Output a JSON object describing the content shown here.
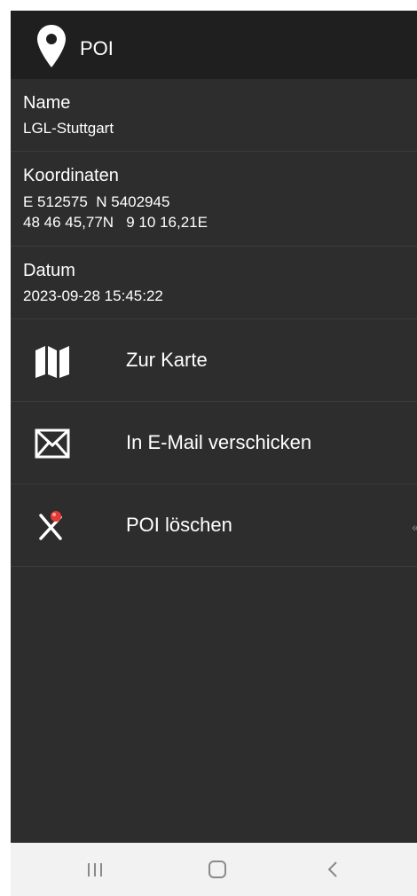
{
  "appbar": {
    "title": "POI",
    "icon": "map-pin-icon"
  },
  "details": {
    "name_label": "Name",
    "name_value": "LGL-Stuttgart",
    "coords_label": "Koordinaten",
    "coords_utm": "E 512575  N 5402945",
    "coords_geo": "48 46 45,77N   9 10 16,21E",
    "date_label": "Datum",
    "date_value": "2023-09-28 15:45:22"
  },
  "actions": [
    {
      "label": "Zur Karte",
      "icon": "map-icon"
    },
    {
      "label": "In E-Mail verschicken",
      "icon": "mail-icon"
    },
    {
      "label": "POI löschen",
      "icon": "delete-pin-icon"
    }
  ],
  "navbar": {
    "recent_icon": "recent-apps-icon",
    "home_icon": "home-icon",
    "back_icon": "back-icon"
  },
  "colors": {
    "background": "#2d2d2d",
    "appbar": "#1f1f1f",
    "text": "#ffffff",
    "divider": "#3c3c3c",
    "delete_accent": "#e53935"
  }
}
